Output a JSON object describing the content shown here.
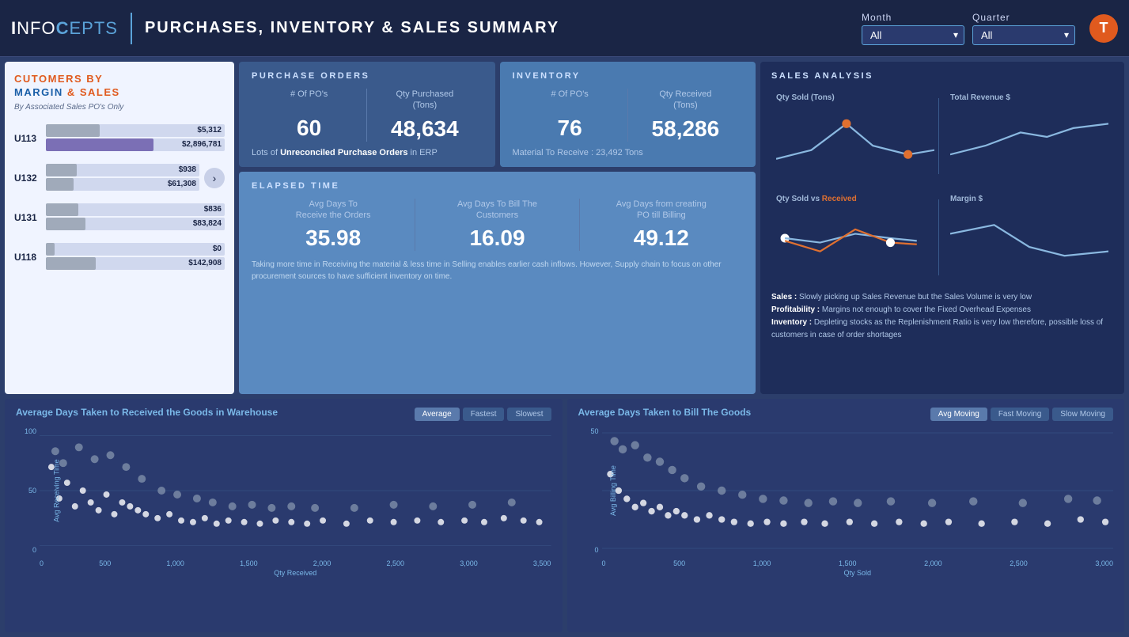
{
  "header": {
    "logo_info": "INFO",
    "logo_cepts": "CEPTS",
    "title": "Purchases, Inventory & Sales Summary",
    "filter_month_label": "Month",
    "filter_quarter_label": "Quarter",
    "filter_month_value": "All",
    "filter_quarter_value": "All",
    "logo_icon": "T"
  },
  "customers": {
    "title_line1": "CUTOMERS BY",
    "title_line2": "MARGIN & SALES",
    "subtitle": "By Associated  Sales PO's Only",
    "items": [
      {
        "id": "U113",
        "val1": "$5,312",
        "val2": "$2,896,781",
        "pct1": 30,
        "pct2": 60
      },
      {
        "id": "U132",
        "val1": "$938",
        "val2": "$61,308",
        "pct1": 20,
        "pct2": 18
      },
      {
        "id": "U131",
        "val1": "$836",
        "val2": "$83,824",
        "pct1": 18,
        "pct2": 22
      },
      {
        "id": "U118",
        "val1": "$0",
        "val2": "$142,908",
        "pct1": 5,
        "pct2": 28
      }
    ]
  },
  "purchase_orders": {
    "title": "PURCHASE ORDERS",
    "col1_label": "# Of PO's",
    "col1_value": "60",
    "col2_label": "Qty Purchased\n(Tons)",
    "col2_value": "48,634",
    "note_prefix": "Lots of ",
    "note_bold": "Unreconciled  Purchase Orders",
    "note_suffix": " in ERP"
  },
  "inventory": {
    "title": "INVENTORY",
    "col1_label": "# Of PO's",
    "col1_value": "76",
    "col2_label": "Qty Received\n(Tons)",
    "col2_value": "58,286",
    "note": "Material To Receive :  23,492 Tons"
  },
  "elapsed_time": {
    "title": "ELAPSED TIME",
    "col1_label": "Avg Days  To\nReceive the Orders",
    "col1_value": "35.98",
    "col2_label": "Avg Days To Bill The\nCustomers",
    "col2_value": "16.09",
    "col3_label": "Avg Days from creating\nPO till Billing",
    "col3_value": "49.12",
    "note": "Taking more time in Receiving the material & less time in Selling enables earlier cash inflows. However, Supply chain to focus on other procurement sources to have sufficient inventory on time."
  },
  "sales_analysis": {
    "title": "SALES ANALYSIS",
    "chart1_label": "Qty Sold (Tons)",
    "chart2_label": "Total Revenue $",
    "chart3_label_prefix": "Qty Sold vs ",
    "chart3_label_highlight": "Received",
    "chart4_label": "Margin $",
    "insight_sales": "Sales : Slowly picking up Sales Revenue but the Sales Volume is very low",
    "insight_profit": "Profitability : Margins not enough to cover the Fixed Overhead Expenses",
    "insight_inv": "Inventory :  Depleting stocks as the Replenishment Ratio is very low therefore, possible loss of customers in case of order shortages"
  },
  "bottom_left": {
    "title": "Average Days Taken to Received the Goods in Warehouse",
    "btn1": "Average",
    "btn2": "Fastest",
    "btn3": "Slowest",
    "axis_y": "Avg Receiving Time",
    "axis_x": "Qty Received",
    "y_max": "100",
    "y_mid": "50",
    "y_min": "0",
    "x_ticks": [
      "0",
      "500",
      "1,000",
      "1,500",
      "2,000",
      "2,500",
      "3,000",
      "3,500"
    ]
  },
  "bottom_right": {
    "title": "Average Days Taken to Bill The Goods",
    "btn1": "Avg Moving",
    "btn2": "Fast Moving",
    "btn3": "Slow Moving",
    "axis_y": "Avg Billing Time",
    "axis_x": "Qty Sold",
    "y_max": "50",
    "y_min": "0",
    "x_ticks": [
      "0",
      "500",
      "1,000",
      "1,500",
      "2,000",
      "2,500",
      "3,000"
    ]
  }
}
